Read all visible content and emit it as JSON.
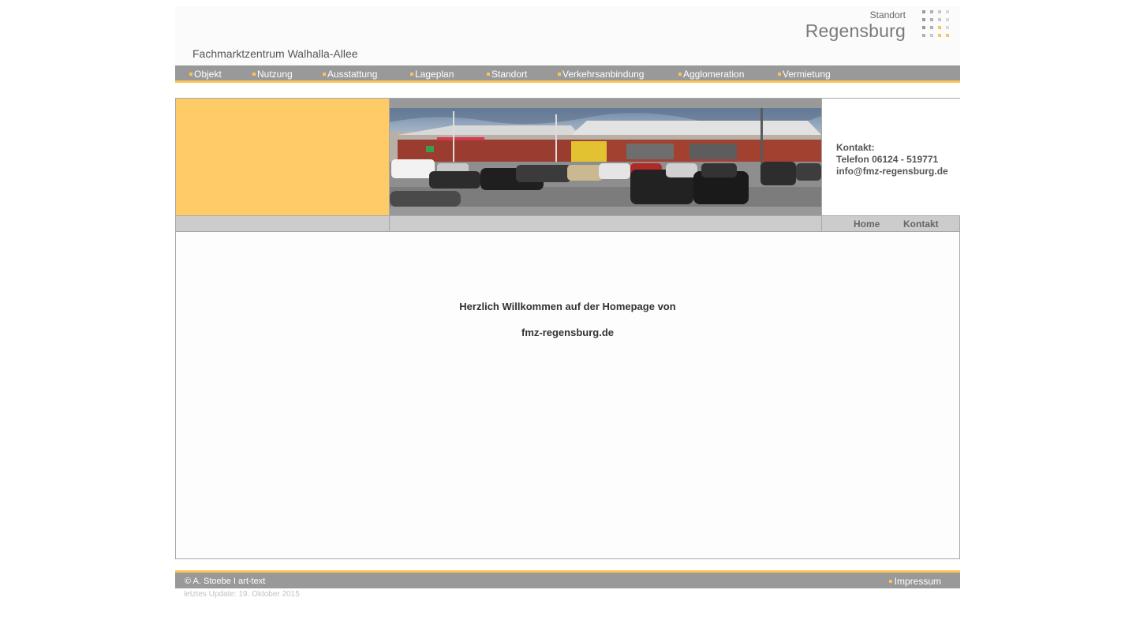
{
  "header": {
    "site_title": "Fachmarktzentrum Walhalla-Allee",
    "logo_small": "Standort",
    "logo_city": "Regensburg",
    "logo_dots": [
      "#9a9a9a",
      "#b0b0b0",
      "#c8c8c8",
      "#d8d8d8",
      "#9a9a9a",
      "#b0b0b0",
      "#c8c8c8",
      "#d8d8d8",
      "#9a9a9a",
      "#b0b0b0",
      "#fdc35a",
      "#d8d8d8",
      "#b0b0b0",
      "#c8c8c8",
      "#fdc35a",
      "#fdc35a"
    ]
  },
  "nav": {
    "items": [
      {
        "label": "Objekt"
      },
      {
        "label": "Nutzung"
      },
      {
        "label": "Ausstattung"
      },
      {
        "label": "Lageplan"
      },
      {
        "label": "Standort"
      },
      {
        "label": "Verkehrsanbindung"
      },
      {
        "label": "Agglomeration"
      },
      {
        "label": "Vermietung"
      }
    ]
  },
  "contact": {
    "heading": "Kontakt:",
    "phone": "Telefon 06124 - 519771",
    "email": "info@fmz-regensburg.de"
  },
  "subnav": {
    "home": "Home",
    "kontakt": "Kontakt"
  },
  "main": {
    "welcome_line1": "Herzlich Willkommen auf der Homepage von",
    "welcome_line2": "fmz-regensburg.de"
  },
  "footer": {
    "copyright": "© A. Stoebe I art-text",
    "impressum": "Impressum",
    "update": "letztes Update: 19. Oktober 2015"
  },
  "colors": {
    "accent": "#fdc35a",
    "bar_gray": "#999999",
    "panel_yellow": "#fecb67"
  }
}
